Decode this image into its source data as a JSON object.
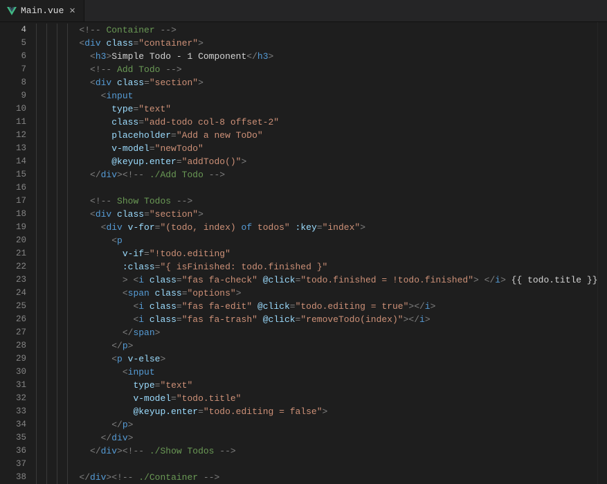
{
  "tab": {
    "filename": "Main.vue",
    "close_glyph": "✕"
  },
  "gutter": {
    "start": 4,
    "end": 38,
    "active": 4
  },
  "tokens": [
    [
      [
        "sp",
        "        "
      ],
      [
        "pun",
        "<!--"
      ],
      [
        "cmt",
        " Container "
      ],
      [
        "pun",
        "-->"
      ]
    ],
    [
      [
        "sp",
        "        "
      ],
      [
        "pun",
        "<"
      ],
      [
        "tag",
        "div"
      ],
      [
        "txt",
        " "
      ],
      [
        "attr",
        "class"
      ],
      [
        "pun",
        "="
      ],
      [
        "str",
        "\"container\""
      ],
      [
        "pun",
        ">"
      ]
    ],
    [
      [
        "sp",
        "          "
      ],
      [
        "pun",
        "<"
      ],
      [
        "tag",
        "h3"
      ],
      [
        "pun",
        ">"
      ],
      [
        "txt",
        "Simple Todo - 1 Component"
      ],
      [
        "pun",
        "</"
      ],
      [
        "tag",
        "h3"
      ],
      [
        "pun",
        ">"
      ]
    ],
    [
      [
        "sp",
        "          "
      ],
      [
        "pun",
        "<!--"
      ],
      [
        "cmt",
        " Add Todo "
      ],
      [
        "pun",
        "-->"
      ]
    ],
    [
      [
        "sp",
        "          "
      ],
      [
        "pun",
        "<"
      ],
      [
        "tag",
        "div"
      ],
      [
        "txt",
        " "
      ],
      [
        "attr",
        "class"
      ],
      [
        "pun",
        "="
      ],
      [
        "str",
        "\"section\""
      ],
      [
        "pun",
        ">"
      ]
    ],
    [
      [
        "sp",
        "            "
      ],
      [
        "pun",
        "<"
      ],
      [
        "tag",
        "input"
      ]
    ],
    [
      [
        "sp",
        "              "
      ],
      [
        "attr",
        "type"
      ],
      [
        "pun",
        "="
      ],
      [
        "str",
        "\"text\""
      ]
    ],
    [
      [
        "sp",
        "              "
      ],
      [
        "attr",
        "class"
      ],
      [
        "pun",
        "="
      ],
      [
        "str",
        "\"add-todo col-8 offset-2\""
      ]
    ],
    [
      [
        "sp",
        "              "
      ],
      [
        "attr",
        "placeholder"
      ],
      [
        "pun",
        "="
      ],
      [
        "str",
        "\"Add a new ToDo\""
      ]
    ],
    [
      [
        "sp",
        "              "
      ],
      [
        "attr",
        "v-model"
      ],
      [
        "pun",
        "="
      ],
      [
        "str",
        "\"newTodo\""
      ]
    ],
    [
      [
        "sp",
        "              "
      ],
      [
        "attr",
        "@keyup.enter"
      ],
      [
        "pun",
        "="
      ],
      [
        "str",
        "\"addTodo()\""
      ],
      [
        "pun",
        ">"
      ]
    ],
    [
      [
        "sp",
        "          "
      ],
      [
        "pun",
        "</"
      ],
      [
        "tag",
        "div"
      ],
      [
        "pun",
        ">"
      ],
      [
        "pun",
        "<!--"
      ],
      [
        "cmt",
        " ./Add Todo "
      ],
      [
        "pun",
        "-->"
      ]
    ],
    [],
    [
      [
        "sp",
        "          "
      ],
      [
        "pun",
        "<!--"
      ],
      [
        "cmt",
        " Show Todos "
      ],
      [
        "pun",
        "-->"
      ]
    ],
    [
      [
        "sp",
        "          "
      ],
      [
        "pun",
        "<"
      ],
      [
        "tag",
        "div"
      ],
      [
        "txt",
        " "
      ],
      [
        "attr",
        "class"
      ],
      [
        "pun",
        "="
      ],
      [
        "str",
        "\"section\""
      ],
      [
        "pun",
        ">"
      ]
    ],
    [
      [
        "sp",
        "            "
      ],
      [
        "pun",
        "<"
      ],
      [
        "tag",
        "div"
      ],
      [
        "txt",
        " "
      ],
      [
        "attr",
        "v-for"
      ],
      [
        "pun",
        "="
      ],
      [
        "str",
        "\"(todo, index) "
      ],
      [
        "kw",
        "of"
      ],
      [
        "str",
        " todos\""
      ],
      [
        "txt",
        " "
      ],
      [
        "attr",
        ":key"
      ],
      [
        "pun",
        "="
      ],
      [
        "str",
        "\"index\""
      ],
      [
        "pun",
        ">"
      ]
    ],
    [
      [
        "sp",
        "              "
      ],
      [
        "pun",
        "<"
      ],
      [
        "tag",
        "p"
      ]
    ],
    [
      [
        "sp",
        "                "
      ],
      [
        "attr",
        "v-if"
      ],
      [
        "pun",
        "="
      ],
      [
        "str",
        "\"!todo.editing\""
      ]
    ],
    [
      [
        "sp",
        "                "
      ],
      [
        "attr",
        ":class"
      ],
      [
        "pun",
        "="
      ],
      [
        "str",
        "\"{ isFinished: todo.finished }\""
      ]
    ],
    [
      [
        "sp",
        "                "
      ],
      [
        "pun",
        ">"
      ],
      [
        "txt",
        " "
      ],
      [
        "pun",
        "<"
      ],
      [
        "tag",
        "i"
      ],
      [
        "txt",
        " "
      ],
      [
        "attr",
        "class"
      ],
      [
        "pun",
        "="
      ],
      [
        "str",
        "\"fas fa-check\""
      ],
      [
        "txt",
        " "
      ],
      [
        "attr",
        "@click"
      ],
      [
        "pun",
        "="
      ],
      [
        "str",
        "\"todo.finished = !todo.finished\""
      ],
      [
        "pun",
        ">"
      ],
      [
        "txt",
        " "
      ],
      [
        "pun",
        "</"
      ],
      [
        "tag",
        "i"
      ],
      [
        "pun",
        ">"
      ],
      [
        "txt",
        " {{ todo.title }}"
      ]
    ],
    [
      [
        "sp",
        "                "
      ],
      [
        "pun",
        "<"
      ],
      [
        "tag",
        "span"
      ],
      [
        "txt",
        " "
      ],
      [
        "attr",
        "class"
      ],
      [
        "pun",
        "="
      ],
      [
        "str",
        "\"options\""
      ],
      [
        "pun",
        ">"
      ]
    ],
    [
      [
        "sp",
        "                  "
      ],
      [
        "pun",
        "<"
      ],
      [
        "tag",
        "i"
      ],
      [
        "txt",
        " "
      ],
      [
        "attr",
        "class"
      ],
      [
        "pun",
        "="
      ],
      [
        "str",
        "\"fas fa-edit\""
      ],
      [
        "txt",
        " "
      ],
      [
        "attr",
        "@click"
      ],
      [
        "pun",
        "="
      ],
      [
        "str",
        "\"todo.editing = true\""
      ],
      [
        "pun",
        "></"
      ],
      [
        "tag",
        "i"
      ],
      [
        "pun",
        ">"
      ]
    ],
    [
      [
        "sp",
        "                  "
      ],
      [
        "pun",
        "<"
      ],
      [
        "tag",
        "i"
      ],
      [
        "txt",
        " "
      ],
      [
        "attr",
        "class"
      ],
      [
        "pun",
        "="
      ],
      [
        "str",
        "\"fas fa-trash\""
      ],
      [
        "txt",
        " "
      ],
      [
        "attr",
        "@click"
      ],
      [
        "pun",
        "="
      ],
      [
        "str",
        "\"removeTodo(index)\""
      ],
      [
        "pun",
        "></"
      ],
      [
        "tag",
        "i"
      ],
      [
        "pun",
        ">"
      ]
    ],
    [
      [
        "sp",
        "                "
      ],
      [
        "pun",
        "</"
      ],
      [
        "tag",
        "span"
      ],
      [
        "pun",
        ">"
      ]
    ],
    [
      [
        "sp",
        "              "
      ],
      [
        "pun",
        "</"
      ],
      [
        "tag",
        "p"
      ],
      [
        "pun",
        ">"
      ]
    ],
    [
      [
        "sp",
        "              "
      ],
      [
        "pun",
        "<"
      ],
      [
        "tag",
        "p"
      ],
      [
        "txt",
        " "
      ],
      [
        "attr",
        "v-else"
      ],
      [
        "pun",
        ">"
      ]
    ],
    [
      [
        "sp",
        "                "
      ],
      [
        "pun",
        "<"
      ],
      [
        "tag",
        "input"
      ]
    ],
    [
      [
        "sp",
        "                  "
      ],
      [
        "attr",
        "type"
      ],
      [
        "pun",
        "="
      ],
      [
        "str",
        "\"text\""
      ]
    ],
    [
      [
        "sp",
        "                  "
      ],
      [
        "attr",
        "v-model"
      ],
      [
        "pun",
        "="
      ],
      [
        "str",
        "\"todo.title\""
      ]
    ],
    [
      [
        "sp",
        "                  "
      ],
      [
        "attr",
        "@keyup.enter"
      ],
      [
        "pun",
        "="
      ],
      [
        "str",
        "\"todo.editing = false\""
      ],
      [
        "pun",
        ">"
      ]
    ],
    [
      [
        "sp",
        "              "
      ],
      [
        "pun",
        "</"
      ],
      [
        "tag",
        "p"
      ],
      [
        "pun",
        ">"
      ]
    ],
    [
      [
        "sp",
        "            "
      ],
      [
        "pun",
        "</"
      ],
      [
        "tag",
        "div"
      ],
      [
        "pun",
        ">"
      ]
    ],
    [
      [
        "sp",
        "          "
      ],
      [
        "pun",
        "</"
      ],
      [
        "tag",
        "div"
      ],
      [
        "pun",
        ">"
      ],
      [
        "pun",
        "<!--"
      ],
      [
        "cmt",
        " ./Show Todos "
      ],
      [
        "pun",
        "-->"
      ]
    ],
    [],
    [
      [
        "sp",
        "        "
      ],
      [
        "pun",
        "</"
      ],
      [
        "tag",
        "div"
      ],
      [
        "pun",
        ">"
      ],
      [
        "pun",
        "<!--"
      ],
      [
        "cmt",
        " ./Container "
      ],
      [
        "pun",
        "-->"
      ]
    ]
  ]
}
